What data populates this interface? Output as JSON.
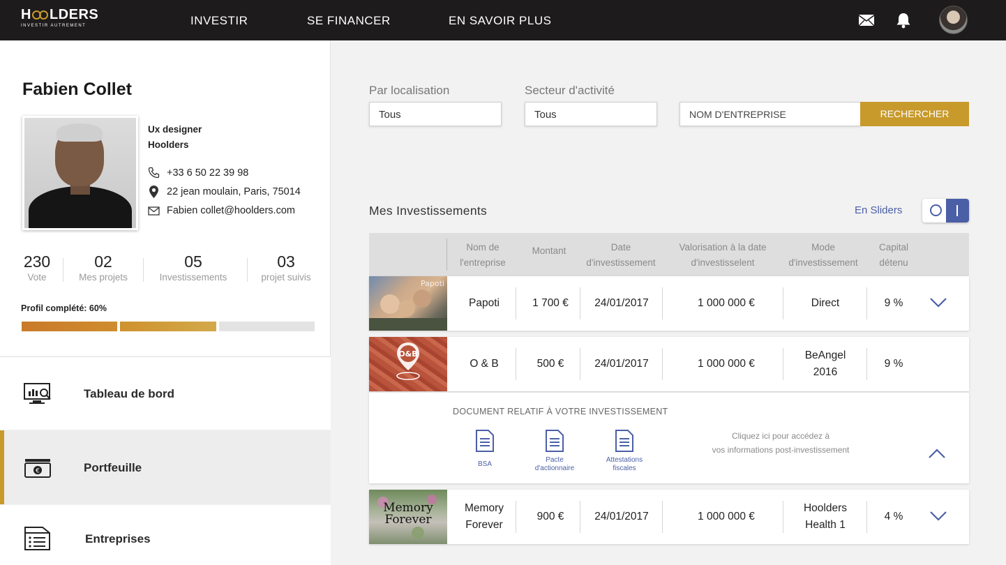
{
  "brand": {
    "name_part1": "H",
    "name_part2": "LDERS",
    "tagline": "INVESTIR AUTREMENT"
  },
  "nav": {
    "items": [
      "INVESTIR",
      "SE FINANCER",
      "EN SAVOIR PLUS"
    ]
  },
  "profile": {
    "name": "Fabien Collet",
    "role": "Ux designer",
    "company": "Hoolders",
    "phone": "+33 6 50 22 39 98",
    "address": "22 jean moulain, Paris, 75014",
    "email": "Fabien collet@hoolders.com",
    "stats": [
      {
        "value": "230",
        "label": "Vote"
      },
      {
        "value": "02",
        "label": "Mes projets"
      },
      {
        "value": "05",
        "label": "Investissements"
      },
      {
        "value": "03",
        "label": "projet suivis"
      }
    ],
    "completion_label": "Profil complété: 60%",
    "completion_percent": 60
  },
  "menu": {
    "items": [
      {
        "label": "Tableau de bord",
        "icon": "dashboard-icon"
      },
      {
        "label": "Portfeuille",
        "icon": "wallet-icon"
      },
      {
        "label": "Entreprises",
        "icon": "list-icon"
      }
    ]
  },
  "filters": {
    "location_label": "Par localisation",
    "location_value": "Tous",
    "sector_label": "Secteur d'activité",
    "sector_value": "Tous",
    "company_placeholder": "NOM D'ENTREPRISE",
    "search_button": "RECHERCHER"
  },
  "investments": {
    "title": "Mes Investissements",
    "view_link": "En Sliders",
    "columns": [
      [
        "Nom de",
        "l'entreprise"
      ],
      [
        "Montant"
      ],
      [
        "Date",
        "d'investissement"
      ],
      [
        "Valorisation à la date",
        "d'investisselent"
      ],
      [
        "Mode",
        "d'investissement"
      ],
      [
        "Capital",
        "détenu"
      ]
    ],
    "rows": [
      {
        "name": [
          "Papoti"
        ],
        "amount": "1 700 €",
        "date": "24/01/2017",
        "valuation": "1 000 000 €",
        "mode": [
          "Direct"
        ],
        "capital": "9 %",
        "expanded": false,
        "thumb_text": "Papoti"
      },
      {
        "name": [
          "O & B"
        ],
        "amount": "500 €",
        "date": "24/01/2017",
        "valuation": "1 000 000 €",
        "mode": [
          "BeAngel",
          "2016"
        ],
        "capital": "9 %",
        "expanded": true,
        "thumb_text": "O&B"
      },
      {
        "name": [
          "Memory",
          "Forever"
        ],
        "amount": "900 €",
        "date": "24/01/2017",
        "valuation": "1 000 000 €",
        "mode": [
          "Hoolders",
          "Health 1"
        ],
        "capital": "4 %",
        "expanded": false,
        "thumb_text": "Memory Forever"
      }
    ],
    "documents": {
      "title": "DOCUMENT RELATIF À VOTRE INVESTISSEMENT",
      "items": [
        {
          "label": [
            "BSA"
          ]
        },
        {
          "label": [
            "Pacte",
            "d'actionnaire"
          ]
        },
        {
          "label": [
            "Attestations",
            "fiscales"
          ]
        }
      ],
      "info": [
        "Cliquez ici pour accédez à",
        "vos informations post-investissement"
      ]
    }
  },
  "colors": {
    "gold": "#c89a2c",
    "dark": "#1d1b1b",
    "accent_blue": "#4b5fa6",
    "progress_start": "#c97a2a"
  }
}
